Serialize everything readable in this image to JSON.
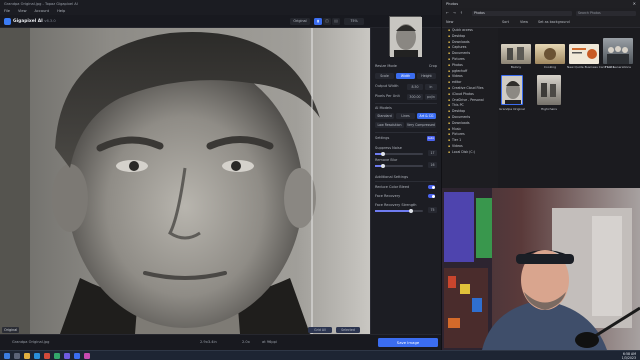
{
  "gigapixel": {
    "title": "Grandpa Original.jpg - Topaz Gigapixel AI",
    "menu": [
      "File",
      "View",
      "Account",
      "Help"
    ],
    "brand": "Gigapixel AI",
    "version": "v6.3.0",
    "toolbar": {
      "view_original": "Original",
      "zoom": "75%"
    },
    "preview_label": "Original",
    "status_filename": "Grandpa Original.jpg",
    "status_size": "2.9x3.4in",
    "status_scale": "2.0x",
    "status_dims": "at 96ppi",
    "panel": {
      "resize_mode": "Resize Mode",
      "crop_label": "Crop",
      "resize_options": [
        "Scale",
        "Width",
        "Height"
      ],
      "output_width_label": "Output Width",
      "output_width_value": "8.50",
      "output_width_unit": "in",
      "ppi_label": "Pixels Per Unit",
      "ppi_value": "300.00",
      "ppi_unit": "px/in",
      "ai_models_label": "AI Models",
      "ai_models": [
        "Standard",
        "Lines",
        "Art & CG"
      ],
      "ai_models2": [
        "Low Resolution",
        "Very Compressed"
      ],
      "settings_label": "Settings",
      "settings_badge": "Auto",
      "suppress_noise_label": "Suppress Noise",
      "suppress_noise_value": "17",
      "remove_blur_label": "Remove Blur",
      "remove_blur_value": "16",
      "additional_settings_label": "Additional Settings",
      "reduce_color_bleed_label": "Reduce Color Bleed",
      "face_recovery_label": "Face Recovery",
      "face_recovery_strength_label": "Face Recovery Strength",
      "face_recovery_strength_value": "75",
      "save_button": "Save Image",
      "bottom_tabs": [
        "Grid All",
        "Selected"
      ]
    }
  },
  "explorer": {
    "title": "Photos",
    "tabs_label": "Photos",
    "address": "Photos",
    "search_placeholder": "Search Photos",
    "toolbar_items": [
      "New",
      "Sort",
      "View",
      "Set as background"
    ],
    "quick_access_label": "Quick access",
    "nav": [
      "Desktop",
      "Downloads",
      "Captures",
      "Documents",
      "Pictures",
      "Photos",
      "pgtechoff",
      "Videos",
      "editor",
      "Creative Cloud Files",
      "iCloud Photos",
      "OneDrive - Personal",
      "This PC",
      "Desktop",
      "Documents",
      "Downloads",
      "Music",
      "Pictures",
      "Tier 1",
      "Videos",
      "Local Disk (C:)"
    ],
    "files": [
      {
        "name": "Balony"
      },
      {
        "name": "Cooking"
      },
      {
        "name": "New Quote Business Card 1024"
      },
      {
        "name": "Four Generations"
      },
      {
        "name": "Grandpa Original"
      },
      {
        "name": "Highchairs"
      }
    ]
  },
  "taskbar": {
    "time": "6:58 AM",
    "date": "1/3/2023"
  },
  "colors": {
    "accent": "#3b6df0",
    "panel_bg": "#1c1d23",
    "taskbar": "#1d2533"
  }
}
